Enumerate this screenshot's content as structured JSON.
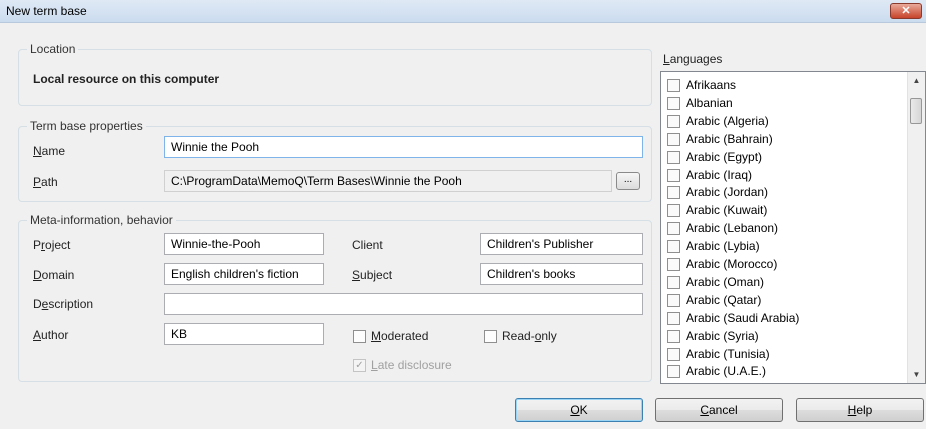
{
  "window": {
    "title": "New term base",
    "close_glyph": "✕"
  },
  "location": {
    "legend": "Location",
    "value": "Local resource on this computer"
  },
  "properties": {
    "legend": "Term base properties",
    "name_label": "Name",
    "name_value": "Winnie the Pooh",
    "path_label": "Path",
    "path_value": "C:\\ProgramData\\MemoQ\\Term Bases\\Winnie the Pooh",
    "browse_label": "..."
  },
  "meta": {
    "legend": "Meta-information, behavior",
    "project_label": "Project",
    "project_value": "Winnie-the-Pooh",
    "client_label": "Client",
    "client_value": "Children's Publisher",
    "domain_label": "Domain",
    "domain_value": "English children's fiction",
    "subject_label": "Subject",
    "subject_value": "Children's books",
    "description_label": "Description",
    "description_value": "",
    "author_label": "Author",
    "author_value": "KB",
    "moderated_label": "Moderated",
    "readonly_label": "Read-only",
    "late_disclosure_label": "Late disclosure"
  },
  "languages": {
    "header": "Languages",
    "items": [
      "Afrikaans",
      "Albanian",
      "Arabic (Algeria)",
      "Arabic (Bahrain)",
      "Arabic (Egypt)",
      "Arabic (Iraq)",
      "Arabic (Jordan)",
      "Arabic (Kuwait)",
      "Arabic (Lebanon)",
      "Arabic (Lybia)",
      "Arabic (Morocco)",
      "Arabic (Oman)",
      "Arabic (Qatar)",
      "Arabic (Saudi Arabia)",
      "Arabic (Syria)",
      "Arabic (Tunisia)",
      "Arabic (U.A.E.)"
    ]
  },
  "buttons": {
    "ok": "OK",
    "cancel": "Cancel",
    "help": "Help"
  }
}
